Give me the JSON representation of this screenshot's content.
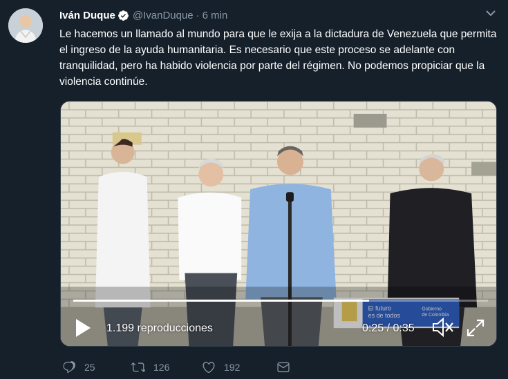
{
  "tweet": {
    "author_name": "Iván Duque",
    "handle": "@IvanDuque",
    "separator": "·",
    "time_ago": "6 min",
    "text": "Le hacemos un llamado al mundo para que le exija a la dictadura de Venezuela que permita el ingreso de la ayuda humanitaria. Es necesario que este proceso se adelante con tranquilidad, pero ha habido violencia por parte del régimen. No podemos propiciar que la violencia continúe."
  },
  "video": {
    "views": "1.199 reproducciones",
    "timecode": "0:25 / 0:35",
    "progress": 0.714,
    "banner_line1": "El futuro",
    "banner_line2": "es de todos",
    "banner_right1": "Gobierno",
    "banner_right2": "de Colombia"
  },
  "actions": {
    "replies": "25",
    "retweets": "126",
    "likes": "192"
  },
  "colors": {
    "background": "#15202b",
    "muted": "#8899a6",
    "verified": "#1da1f2"
  },
  "icons": [
    "verified-badge-icon",
    "chevron-down-icon",
    "play-icon",
    "mute-icon",
    "fullscreen-icon",
    "reply-icon",
    "retweet-icon",
    "like-icon",
    "dm-icon"
  ]
}
